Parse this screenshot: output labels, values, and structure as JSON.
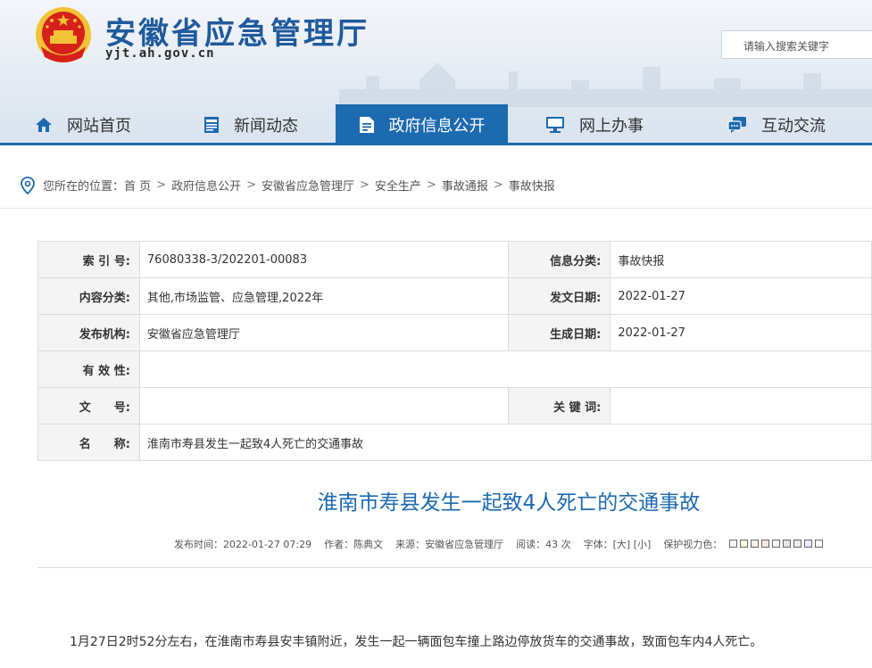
{
  "header": {
    "site_title": "安徽省应急管理厅",
    "site_domain": "yjt.ah.gov.cn",
    "search_placeholder": "请输入搜索关键字"
  },
  "nav": {
    "items": [
      {
        "label": "网站首页",
        "icon": "home-icon",
        "active": false
      },
      {
        "label": "新闻动态",
        "icon": "news-icon",
        "active": false
      },
      {
        "label": "政府信息公开",
        "icon": "document-icon",
        "active": true
      },
      {
        "label": "网上办事",
        "icon": "monitor-icon",
        "active": false
      },
      {
        "label": "互动交流",
        "icon": "chat-icon",
        "active": false
      }
    ]
  },
  "breadcrumb": {
    "prefix": "您所在的位置：",
    "items": [
      "首 页",
      "政府信息公开",
      "安徽省应急管理厅",
      "安全生产",
      "事故通报",
      "事故快报"
    ]
  },
  "info": {
    "index_label": "索 引 号:",
    "index_value": "76080338-3/202201-00083",
    "category_label": "信息分类:",
    "category_value": "事故快报",
    "content_label": "内容分类:",
    "content_value": "其他,市场监管、应急管理,2022年",
    "issue_date_label": "发文日期:",
    "issue_date_value": "2022-01-27",
    "publisher_label": "发布机构:",
    "publisher_value": "安徽省应急管理厅",
    "effective_date_label": "生成日期:",
    "effective_date_value": "2022-01-27",
    "validity_label": "有 效 性:",
    "validity_value": "",
    "doc_no_label": "文　　号:",
    "doc_no_value": "",
    "keywords_label": "关 键 词:",
    "keywords_value": "",
    "name_label": "名　　称:",
    "name_value": "淮南市寿县发生一起致4人死亡的交通事故"
  },
  "article": {
    "title": "淮南市寿县发生一起致4人死亡的交通事故",
    "publish_time": "发布时间：2022-01-27 07:29",
    "author": "作者：陈典文",
    "source": "来源：安徽省应急管理厅",
    "reads": "阅读：43 次",
    "font_size_label": "字体：",
    "font_large": "[大]",
    "font_small": "[小]",
    "eye_care_label": "保护视力色：",
    "body": "1月27日2时52分左右，在淮南市寿县安丰镇附近，发生一起一辆面包车撞上路边停放货车的交通事故，致面包车内4人死亡。"
  },
  "colors": {
    "brand_blue": "#1c6ab0",
    "emblem_red": "#d7201a",
    "emblem_gold": "#f3c235"
  }
}
